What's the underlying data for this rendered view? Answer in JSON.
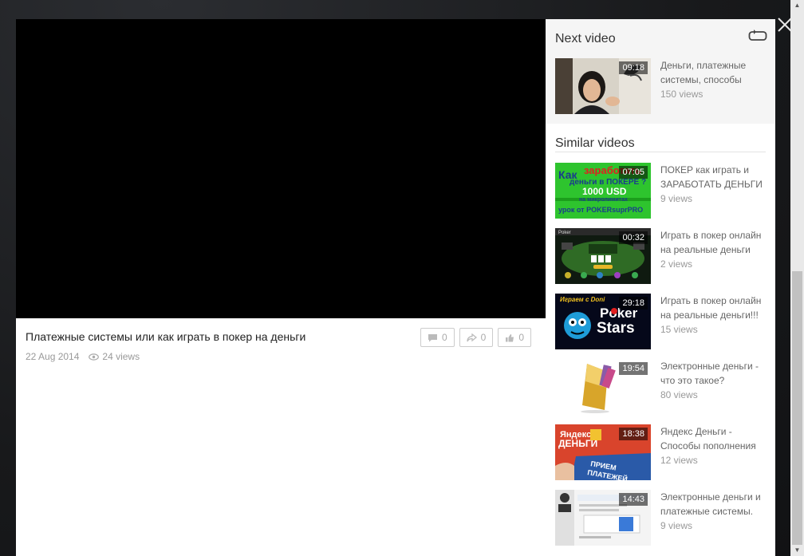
{
  "video": {
    "title": "Платежные системы или как играть в покер на деньги",
    "date": "22 Aug 2014",
    "views": "24 views",
    "comments": "0",
    "shares": "0",
    "likes": "0"
  },
  "next_video": {
    "heading": "Next video",
    "item": {
      "title": "Деньги, платежные системы, способы",
      "views": "150 views",
      "duration": "09:18"
    }
  },
  "similar": {
    "heading": "Similar videos",
    "items": [
      {
        "title": "ПОКЕР как играть и ЗАРАБОТАТЬ ДЕНЬГИ",
        "views": "9 views",
        "duration": "07:05"
      },
      {
        "title": "Играть в покер онлайн на реальные деньги",
        "views": "2 views",
        "duration": "00:32"
      },
      {
        "title": "Играть в покер онлайн на реальные деньги!!!",
        "views": "15 views",
        "duration": "29:18"
      },
      {
        "title": "Электронные деньги - что это такое?",
        "views": "80 views",
        "duration": "19:54"
      },
      {
        "title": "Яндекс Деньги - Способы пополнения",
        "views": "12 views",
        "duration": "18:38"
      },
      {
        "title": "Электронные деньги и платежные системы.",
        "views": "9 views",
        "duration": "14:43"
      }
    ]
  },
  "thumb_text": {
    "t1": [
      "Как",
      "заработать",
      "деньги в ПОКЕРЕ ?",
      "1000 USD",
      "на микролимитах",
      "урок от POKERsuprPRO"
    ],
    "t2": "Poker",
    "t3": [
      "Играем с Doni",
      "Poker",
      "Stars"
    ],
    "t5": [
      "Яндекс",
      "ДЕНЬГИ",
      "ПРИЕМ",
      "ПЛАТЕЖЕЙ"
    ]
  },
  "colors": {
    "accent_green": "#2ec42e",
    "poker_blue": "#1a3c8c",
    "yandex_red": "#d9442c"
  }
}
